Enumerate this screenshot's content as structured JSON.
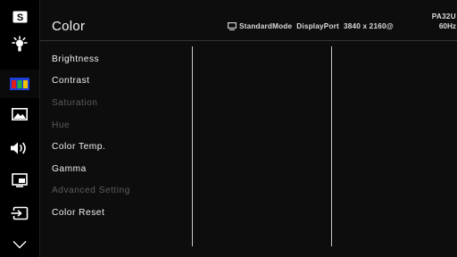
{
  "sidebar": {
    "items": [
      {
        "icon": "s-badge-icon"
      },
      {
        "icon": "brightness-icon"
      },
      {
        "icon": "color-bars-icon",
        "active": true
      },
      {
        "icon": "picture-icon"
      },
      {
        "icon": "speaker-icon"
      },
      {
        "icon": "pip-icon"
      },
      {
        "icon": "input-source-icon"
      },
      {
        "icon": "chevron-down-icon"
      }
    ]
  },
  "header": {
    "title": "Color",
    "mode": "StandardMode",
    "input": "DisplayPort",
    "resolution": "3840 x 2160@",
    "refresh": "60Hz",
    "model": "PA32U"
  },
  "menu": {
    "items": [
      {
        "label": "Brightness",
        "enabled": true
      },
      {
        "label": "Contrast",
        "enabled": true
      },
      {
        "label": "Saturation",
        "enabled": false
      },
      {
        "label": "Hue",
        "enabled": false
      },
      {
        "label": "Color Temp.",
        "enabled": true
      },
      {
        "label": "Gamma",
        "enabled": true
      },
      {
        "label": "Advanced Setting",
        "enabled": false
      },
      {
        "label": "Color Reset",
        "enabled": true
      }
    ]
  },
  "colors": {
    "background": "#000000",
    "panel": "#0d0d0d",
    "text": "#f0f0f0",
    "disabled_text": "#5c5c5c",
    "accent_blue": "#1e40d8",
    "accent_red": "#e11b1b",
    "accent_green": "#22b33a",
    "accent_yellow": "#f2c400"
  }
}
